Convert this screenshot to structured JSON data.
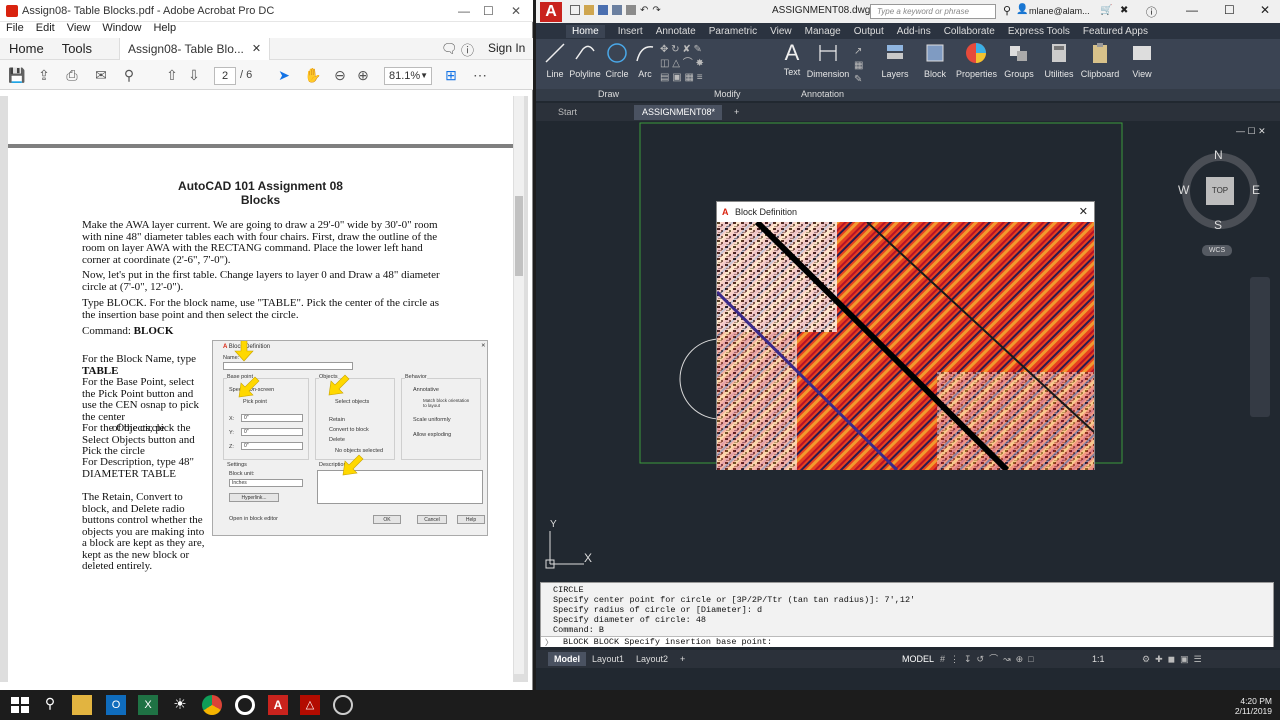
{
  "acrobat": {
    "title": "Assign08- Table Blocks.pdf - Adobe Acrobat Pro DC",
    "menu": [
      "File",
      "Edit",
      "View",
      "Window",
      "Help"
    ],
    "tabs": {
      "home": "Home",
      "tools": "Tools",
      "doc": "Assign08- Table Blo..."
    },
    "sign_in": "Sign In",
    "page_current": "2",
    "page_total": "/ 6",
    "zoom": "81.1%",
    "doc": {
      "title_line1": "AutoCAD 101 Assignment 08",
      "title_line2": "Blocks",
      "para1": "Make the AWA layer current. We are going to draw a 29'-0\" wide by 30'-0\" room with nine 48\" diameter tables each with four chairs. First, draw the outline of the room on layer AWA with the RECTANG command. Place the lower left hand corner at coordinate (2'-6\", 7'-0\").",
      "para2": "Now, let's put in the first table. Change layers to layer 0 and Draw a 48\" diameter circle at (7'-0\", 12'-0\").",
      "para3": "Type BLOCK. For the block name, use \"TABLE\". Pick the center of the circle as the insertion base point and then select the circle.",
      "command_prefix": "Command: ",
      "command": "BLOCK",
      "side1": "For the Block Name, type",
      "side1b": "TABLE",
      "side2": "For the Base Point, select the Pick Point button and use the CEN osnap to pick the center",
      "side2b": "of the circle",
      "side3": "For the Objects, pick the Select Objects button and Pick the circle",
      "side4": "For Description, type 48\"",
      "side4b": "DIAMETER TABLE",
      "side5": "The Retain, Convert to block, and Delete radio buttons control whether the objects you are making into a block are kept as they are, kept as the new block or deleted entirely."
    },
    "mini_dialog": {
      "title": "Block Definition",
      "name": "Name:",
      "base_point": "Base point",
      "specify_on_screen": "Specify On-screen",
      "pick_point": "Pick point",
      "x": "X:",
      "y": "Y:",
      "z": "Z:",
      "xv": "0\"",
      "yv": "0\"",
      "zv": "0\"",
      "objects": "Objects",
      "select_objects": "Select objects",
      "retain": "Retain",
      "convert": "Convert to block",
      "delete": "Delete",
      "no_objects": "No objects selected",
      "behavior": "Behavior",
      "annotative": "Annotative",
      "match": "Match block orientation to layout",
      "scale_uniform": "Scale uniformly",
      "allow_exploding": "Allow exploding",
      "settings": "Settings",
      "block_unit": "Block unit:",
      "unit_value": "Inches",
      "hyperlink": "Hyperlink...",
      "description": "Description",
      "open_editor": "Open in block editor",
      "ok": "OK",
      "cancel": "Cancel",
      "help": "Help"
    }
  },
  "autocad": {
    "file_title": "ASSIGNMENT08.dwg",
    "search_placeholder": "Type a keyword or phrase",
    "user": "mlane@alam...",
    "ribbon_tabs": [
      "Home",
      "Insert",
      "Annotate",
      "Parametric",
      "View",
      "Manage",
      "Output",
      "Add-ins",
      "Collaborate",
      "Express Tools",
      "Featured Apps"
    ],
    "tools": {
      "line": "Line",
      "polyline": "Polyline",
      "circle": "Circle",
      "arc": "Arc",
      "text": "Text",
      "dimension": "Dimension",
      "layers": "Layers",
      "block": "Block",
      "properties": "Properties",
      "groups": "Groups",
      "utilities": "Utilities",
      "clipboard": "Clipboard",
      "view": "View"
    },
    "panels": {
      "draw": "Draw",
      "modify": "Modify",
      "annotation": "Annotation"
    },
    "doc_tabs": {
      "start": "Start",
      "current": "ASSIGNMENT08*"
    },
    "viewcube": {
      "n": "N",
      "s": "S",
      "e": "E",
      "w": "W",
      "top": "TOP",
      "wcs": "WCS"
    },
    "ucs": {
      "x": "X",
      "y": "Y"
    },
    "dialog_title": "Block Definition",
    "command_history": [
      "CIRCLE",
      "Specify center point for circle or [3P/2P/Ttr (tan tan radius)]: 7',12'",
      "Specify radius of circle or [Diameter]: d",
      "Specify diameter of circle: 48",
      "Command: B"
    ],
    "command_prompt": "BLOCK BLOCK Specify insertion base point:",
    "layout_tabs": {
      "model": "Model",
      "l1": "Layout1",
      "l2": "Layout2"
    },
    "status": {
      "model": "MODEL",
      "scale": "1:1"
    }
  },
  "taskbar": {
    "time": "4:20 PM",
    "date": "2/11/2019"
  },
  "colors": {
    "acad_bg": "#212830",
    "accent_red": "#d9230f",
    "arrow_yellow": "#ffd800"
  }
}
